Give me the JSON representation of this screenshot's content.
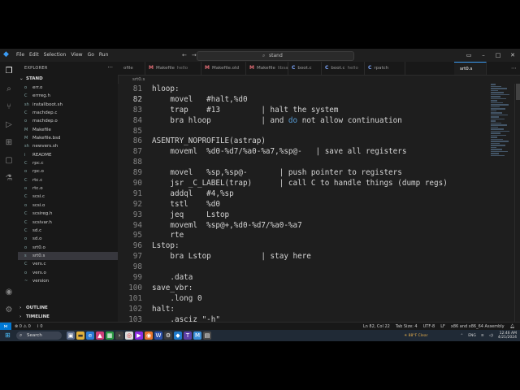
{
  "menu": [
    "File",
    "Edit",
    "Selection",
    "View",
    "Go",
    "Run"
  ],
  "search": {
    "text": "stand"
  },
  "explorer": {
    "header": "EXPLORER",
    "section": "STAND",
    "files": [
      "err.o",
      "errreg.h",
      "installboot.sh",
      "machdep.c",
      "machdep.o",
      "Makefile",
      "Makefile.bsd",
      "newvers.sh",
      "README",
      "rpc.c",
      "rpc.o",
      "rtc.c",
      "rtc.o",
      "scsi.c",
      "scsi.o",
      "scsireg.h",
      "scsivar.h",
      "sd.c",
      "sd.o",
      "srt0.o",
      "srt0.s",
      "vers.c",
      "vers.o",
      "version"
    ],
    "icons": [
      "o",
      "C",
      "sh",
      "C",
      "o",
      "M",
      "M",
      "sh",
      "i",
      "C",
      "o",
      "C",
      "o",
      "C",
      "o",
      "C",
      "C",
      "C",
      "o",
      "o",
      "s",
      "C",
      "o",
      "~"
    ],
    "selected_index": 20,
    "outline": "OUTLINE",
    "timeline": "TIMELINE"
  },
  "tabs": [
    {
      "icon": "",
      "name": "ofile",
      "desc": ""
    },
    {
      "icon": "M",
      "name": "Makefile",
      "desc": "hello"
    },
    {
      "icon": "M",
      "name": "Makefile.old",
      "desc": ""
    },
    {
      "icon": "M",
      "name": "Makefile",
      "desc": "libsa"
    },
    {
      "icon": "C",
      "name": "boot.c",
      "desc": ""
    },
    {
      "icon": "C",
      "name": "boot.c",
      "desc": "hello"
    },
    {
      "icon": "C",
      "name": "rpatch",
      "desc": ""
    },
    {
      "icon": "",
      "name": "srt0.s",
      "desc": ""
    }
  ],
  "breadcrumb": "srt0.s",
  "code": [
    {
      "n": "81",
      "t": "hloop:"
    },
    {
      "n": "82",
      "t": "    movel   #halt,%d0"
    },
    {
      "n": "83",
      "t": "    trap    #13         | halt the system"
    },
    {
      "n": "84",
      "t": "    bra hloop           | and do not allow continuation"
    },
    {
      "n": "85",
      "t": ""
    },
    {
      "n": "86",
      "t": "ASENTRY_NOPROFILE(astrap)"
    },
    {
      "n": "87",
      "t": "    moveml  %d0-%d7/%a0-%a7,%sp@-   | save all registers"
    },
    {
      "n": "88",
      "t": ""
    },
    {
      "n": "89",
      "t": "    movel   %sp,%sp@-       | push pointer to registers"
    },
    {
      "n": "90",
      "t": "    jsr _C_LABEL(trap)      | call C to handle things (dump regs)"
    },
    {
      "n": "91",
      "t": "    addql   #4,%sp"
    },
    {
      "n": "92",
      "t": "    tstl    %d0"
    },
    {
      "n": "93",
      "t": "    jeq     Lstop"
    },
    {
      "n": "94",
      "t": "    moveml  %sp@+,%d0-%d7/%a0-%a7"
    },
    {
      "n": "95",
      "t": "    rte"
    },
    {
      "n": "96",
      "t": "Lstop:"
    },
    {
      "n": "97",
      "t": "    bra Lstop           | stay here"
    },
    {
      "n": "98",
      "t": ""
    },
    {
      "n": "99",
      "t": "    .data"
    },
    {
      "n": "100",
      "t": "save_vbr:"
    },
    {
      "n": "101",
      "t": "    .long 0"
    },
    {
      "n": "102",
      "t": "halt:"
    },
    {
      "n": "103",
      "t": "    .asciz \"-h\""
    }
  ],
  "current_line": "82",
  "status": {
    "problems": "⊗ 0 ⚠ 0",
    "ports": "⌇ 0",
    "position": "Ln 82, Col 22",
    "tabsize": "Tab Size: 4",
    "encoding": "UTF-8",
    "eol": "LF",
    "language": "x86 and x86_64 Assembly"
  },
  "taskbar": {
    "search": "Search",
    "weather_temp": "88°F",
    "weather_desc": "Clear",
    "lang": "ENG",
    "time": "12:46 AM",
    "date": "4/21/2024"
  },
  "colors": {
    "accent": "#0078d4",
    "keyword": "#569cd6"
  }
}
